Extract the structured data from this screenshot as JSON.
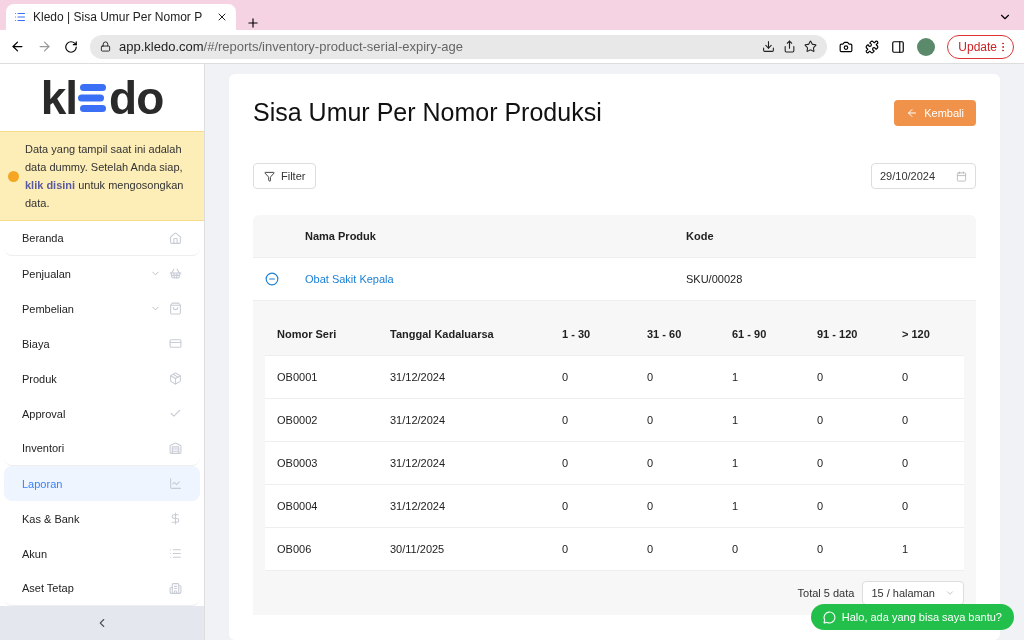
{
  "browser": {
    "tab_title": "Kledo | Sisa Umur Per Nomor P",
    "url_host": "app.kledo.com",
    "url_path": "/#/reports/inventory-product-serial-expiry-age",
    "update_label": "Update"
  },
  "sidebar": {
    "logo": {
      "left": "kl",
      "right": "do"
    },
    "notice": {
      "text": "Data yang tampil saat ini adalah data dummy. Setelah Anda siap, **klik disini** untuk mengosongkan data."
    },
    "items": [
      {
        "label": "Beranda",
        "submenu": false,
        "selected": false
      },
      {
        "label": "Penjualan",
        "submenu": true,
        "selected": false
      },
      {
        "label": "Pembelian",
        "submenu": true,
        "selected": false
      },
      {
        "label": "Biaya",
        "submenu": false,
        "selected": false
      },
      {
        "label": "Produk",
        "submenu": false,
        "selected": false
      },
      {
        "label": "Approval",
        "submenu": false,
        "selected": false
      },
      {
        "label": "Inventori",
        "submenu": false,
        "selected": false
      },
      {
        "label": "Laporan",
        "submenu": false,
        "selected": true
      },
      {
        "label": "Kas & Bank",
        "submenu": false,
        "selected": false
      },
      {
        "label": "Akun",
        "submenu": false,
        "selected": false
      },
      {
        "label": "Aset Tetap",
        "submenu": false,
        "selected": false
      }
    ]
  },
  "page": {
    "title": "Sisa Umur Per Nomor Produksi",
    "back_button": "Kembali",
    "filter_button": "Filter",
    "date": "29/10/2024"
  },
  "table": {
    "columns": [
      "Nama Produk",
      "Kode"
    ],
    "rows": [
      {
        "name": "Obat Sakit Kepala",
        "code": "SKU/00028",
        "expanded": true
      }
    ]
  },
  "detail_table": {
    "columns": [
      "Nomor Seri",
      "Tanggal Kadaluarsa",
      "1 - 30",
      "31 - 60",
      "61 - 90",
      "91 - 120",
      "> 120"
    ],
    "rows": [
      [
        "OB0001",
        "31/12/2024",
        "0",
        "0",
        "1",
        "0",
        "0"
      ],
      [
        "OB0002",
        "31/12/2024",
        "0",
        "0",
        "1",
        "0",
        "0"
      ],
      [
        "OB0003",
        "31/12/2024",
        "0",
        "0",
        "1",
        "0",
        "0"
      ],
      [
        "OB0004",
        "31/12/2024",
        "0",
        "0",
        "1",
        "0",
        "0"
      ],
      [
        "OB006",
        "30/11/2025",
        "0",
        "0",
        "0",
        "0",
        "1"
      ]
    ]
  },
  "pagination": {
    "total": "Total 5 data",
    "page_size": "15 / halaman"
  },
  "chat_button": "Halo, ada yang bisa saya bantu?"
}
